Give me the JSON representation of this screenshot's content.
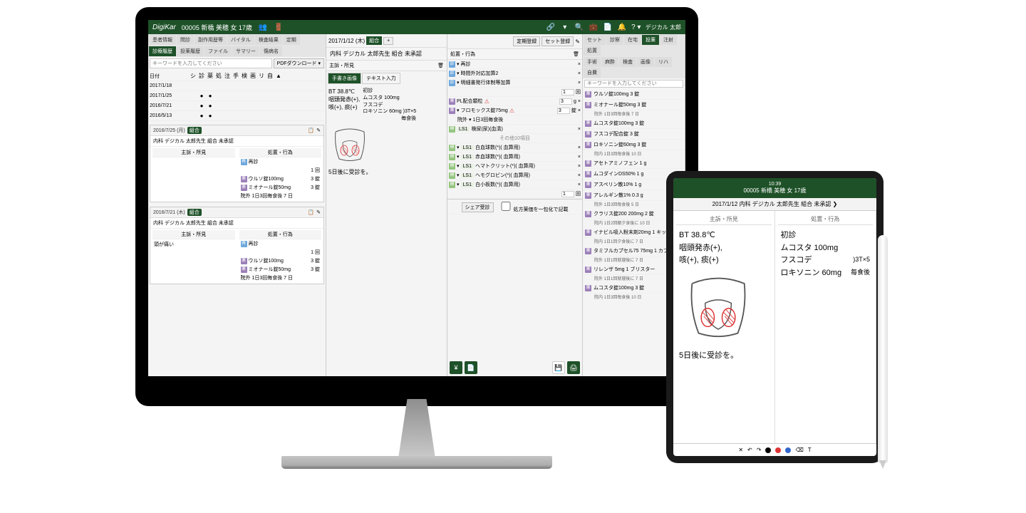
{
  "header": {
    "logo": "DigiKar",
    "patient": "00005 新橋 美穂 女 17歳",
    "user": "デジカル 太郎"
  },
  "leftTabs": {
    "r1": [
      "患者情報",
      "問診",
      "副作用歴等",
      "バイタル",
      "検査結果",
      "定期"
    ],
    "r2": [
      "診療履歴",
      "投薬履歴",
      "ファイル",
      "サマリー",
      "傷病名"
    ]
  },
  "search": {
    "ph": "キーワードを入力してください",
    "pdfBtn": "PDFダウンロード ▾"
  },
  "dateHdr": "日付",
  "dates": [
    "2017/1/18",
    "2017/1/25",
    "2016/7/21",
    "2016/5/13"
  ],
  "card1": {
    "date": "2016/7/25 (月)",
    "tag": "組合",
    "sub": "内科  デジカル 太郎先生  組合  未承認",
    "lbls": [
      "主訴・所見",
      "処置・行為"
    ],
    "symptom": "",
    "act1": "再診",
    "act1b": "1 回",
    "med1": "ウルソ錠100mg",
    "med1q": "3   錠",
    "med2": "ミオナール錠50mg",
    "med2q": "3   錠",
    "dose": "院外          1日3回毎食後 7 日"
  },
  "card2": {
    "date": "2016/7/21 (木)",
    "tag": "組合",
    "sub": "内科  デジカル 太郎先生  組合  未承認",
    "symptom": "頭が痛い",
    "act1": "再診",
    "act1b": "1 回",
    "med1": "ウルソ錠100mg",
    "med1q": "3   錠",
    "med2": "ミオナール錠50mg",
    "med2q": "3   錠",
    "dose": "院外          1日3回毎食後 7 日"
  },
  "center": {
    "date": "2017/1/12 (木)",
    "tag": "組合",
    "plus": "+",
    "reg": "定期登録",
    "set": "セット登録",
    "title": "内科  デジカル 太郎先生  組合  未承認",
    "secL": "主訴・所見",
    "inputTabs": [
      "手書き画像",
      "テキスト入力"
    ],
    "hand1": "BT 38.8℃",
    "hand2": "咽頭発赤(+),",
    "hand3": "咳(+), 痰(+)",
    "hand4": "初診",
    "hand5": "ムコスタ 100mg",
    "hand6": "フスコデ",
    "hand7": "ロキソニン 60mg",
    "hand8": "3T×5",
    "hand9": "毎食後",
    "hand10": "5日後に受診を。"
  },
  "actions": {
    "sec": "処置・行為",
    "rows": [
      {
        "c": "bl",
        "t": "再診"
      },
      {
        "c": "bl",
        "t": "時間外対応加算2"
      },
      {
        "c": "bl",
        "t": "明細書発行体制等加算"
      }
    ],
    "pl": "PL配合顆粒",
    "fromox": "フロモックス錠75mg",
    "fqty": "3",
    "funit": "錠",
    "fdose": "院外 ▾   1日3回毎食後",
    "lab": "検尿(尿)(血清)",
    "other": "その他10項目",
    "labs": [
      {
        "n": "白血球数(*)( 血算用)"
      },
      {
        "n": "赤血球数(*)( 血算用)"
      },
      {
        "n": "ヘマトクリット(*)( 血算用)"
      },
      {
        "n": "ヘモグロビン(*)( 血算用)"
      },
      {
        "n": "白小板数(*)( 血算用)"
      }
    ],
    "share": "シェア受診",
    "pack": "処方薬価を一包化で記載"
  },
  "rightTabs": {
    "r1": [
      "セット",
      "診察",
      "在宅",
      "投薬",
      "注射",
      "処置"
    ],
    "r2": [
      "手術",
      "麻酔",
      "検査",
      "画像",
      "リハ",
      "自費"
    ]
  },
  "rightSearch": "キーワードを入力してください",
  "drugs": [
    {
      "c": "pu",
      "n": "ウルソ錠100mg 3 錠",
      "d": ""
    },
    {
      "c": "pu",
      "n": "ミオナール錠50mg 3 錠",
      "d": "院外 1日3回毎食後 7 日"
    },
    {
      "c": "pu",
      "n": "ムコスタ錠100mg 3 錠",
      "d": ""
    },
    {
      "c": "pu",
      "n": "フスコデ配合錠 3 錠",
      "d": ""
    },
    {
      "c": "pu",
      "n": "ロキソニン錠60mg 3 錠",
      "d": "院内 1日3回毎食後 10 日"
    },
    {
      "c": "pu",
      "n": "アセトアミノフェン 1 g",
      "d": ""
    },
    {
      "c": "pu",
      "n": "ムコダインDS50% 1 g",
      "d": ""
    },
    {
      "c": "pu",
      "n": "アスペリン散10% 1 g",
      "d": ""
    },
    {
      "c": "pu",
      "n": "アレルギン散1% 0.3 g",
      "d": "院外 1日3回毎食後 5 日"
    },
    {
      "c": "pu",
      "n": "クラリス錠200 200mg 2 錠",
      "d": "院内 1日2回朝夕食後に 10 日"
    },
    {
      "c": "pu",
      "n": "イナビル吸入粉末剤20mg 1 キット",
      "d": "院内 1日1回夕食後に 7 日"
    },
    {
      "c": "pu",
      "n": "タミフルカプセル75 75mg 1 カプセル",
      "d": "院外 1日1回就寝後に 7 日"
    },
    {
      "c": "pu",
      "n": "リレンザ 5mg 1 ブリスター",
      "d": "院外 1日1回就寝後に 7 日"
    },
    {
      "c": "pu",
      "n": "ムコスタ錠100mg 3 錠",
      "d": "院内 1日3回毎食後 10 日"
    }
  ],
  "tablet": {
    "time": "10:39",
    "pat": "00005 新橋 美穂 女 17歳",
    "sub": "2017/1/12 内科 デジカル 太郎先生 組合 未承認  ❯",
    "colL": "主訴・所見",
    "colR": "処置・行為",
    "h1": "BT 38.8℃",
    "h2": "咽頭発赤(+),",
    "h3": "咳(+), 痰(+)",
    "h4": "5日後に受診を。",
    "r1": "初診",
    "r2": "ムコスタ 100mg",
    "r3": "フスコデ",
    "r4": "ロキソニン 60mg",
    "r5": "3T×5",
    "r6": "毎食後"
  }
}
